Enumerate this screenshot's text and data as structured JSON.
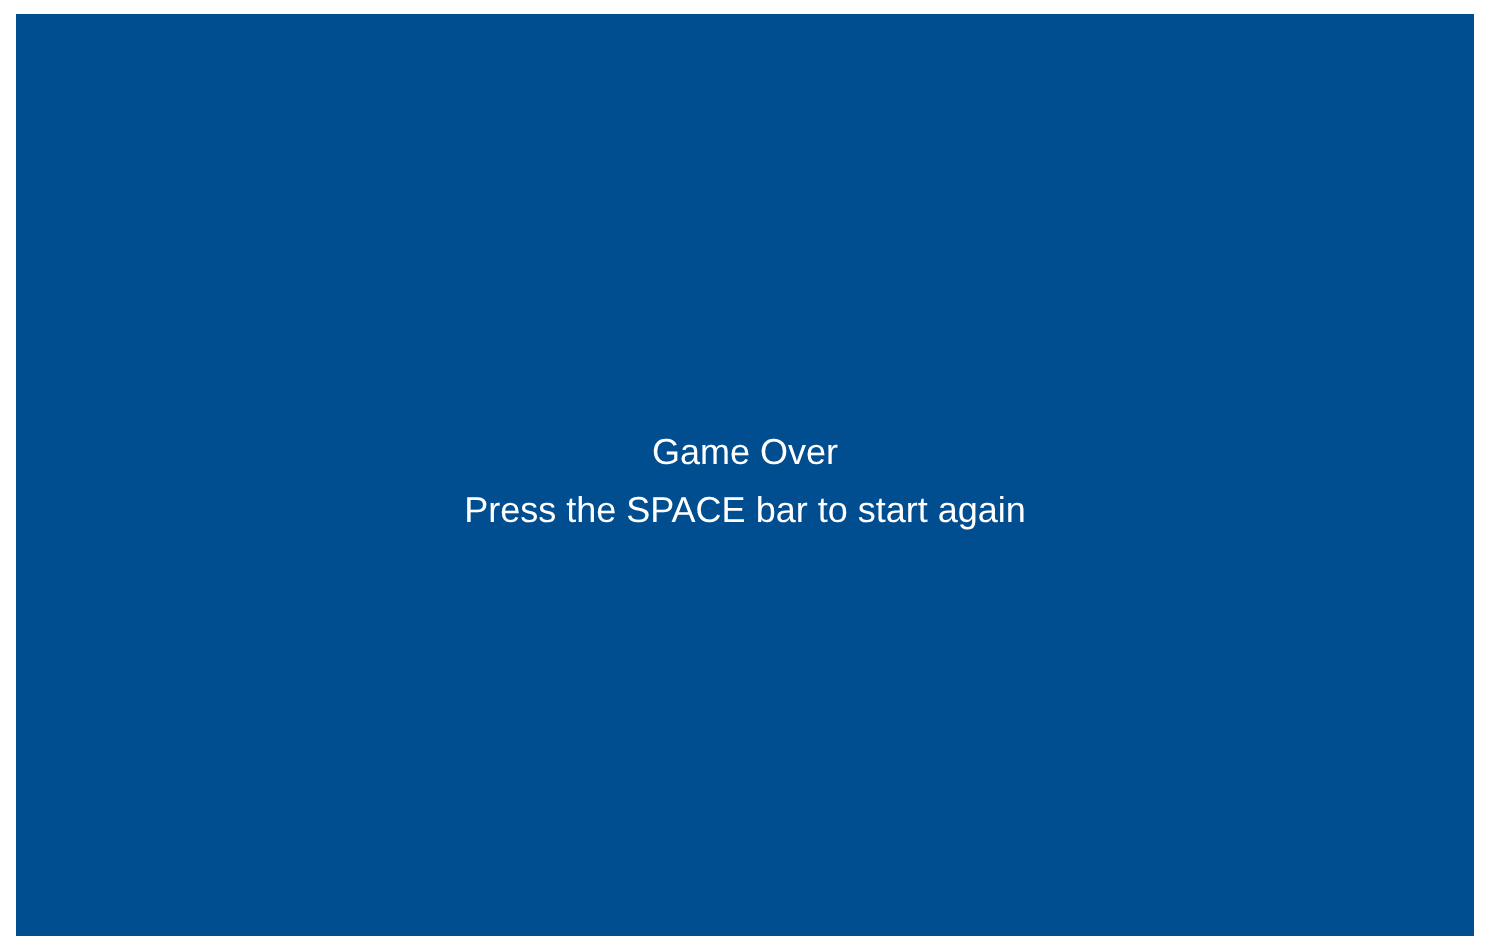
{
  "game_screen": {
    "title": "Game Over",
    "message": "Press the SPACE bar to start again"
  }
}
